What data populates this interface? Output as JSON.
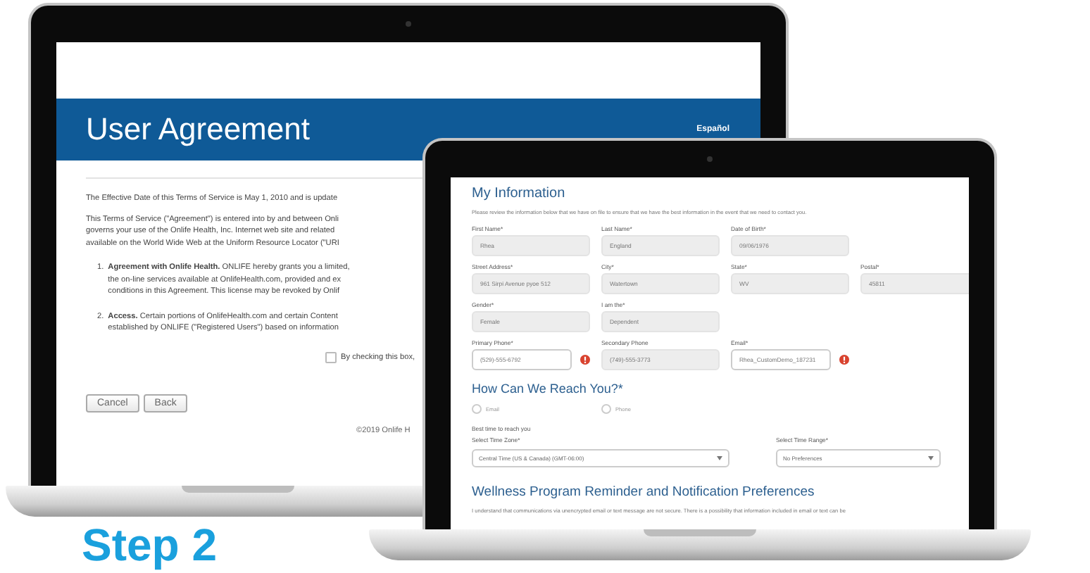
{
  "back_screen": {
    "title": "User Agreement",
    "language_link": "Español",
    "paragraphs": [
      [
        "The Effective Date of this Terms of Service is May 1, 2010 and is update"
      ],
      [
        "This Terms of Service (\"Agreement\") is entered into by and between Onli",
        "governs your use of the Onlife Health, Inc. Internet web site and related",
        "available on the World Wide Web at the Uniform Resource Locator (\"URI"
      ]
    ],
    "list": [
      {
        "number": "1.",
        "lines": [
          "**Agreement with Onlife Health.** ONLIFE hereby grants you a limited,",
          "the on-line services available at OnlifeHealth.com, provided and ex",
          "conditions in this Agreement. This license may be revoked by Onlif"
        ]
      },
      {
        "number": "2.",
        "lines": [
          "**Access.** Certain portions of OnlifeHealth.com and certain Content",
          "established by ONLIFE (\"Registered Users\") based on information"
        ]
      }
    ],
    "consent": {
      "label": "By checking this box,",
      "checked": false
    },
    "buttons": [
      "Cancel",
      "Back"
    ],
    "footer": "©2019 Onlife H"
  },
  "front_screen": {
    "title": "My Information",
    "intro": "Please review the information below that we have on file to ensure that we have the best information in the event that we need to contact you.",
    "field_rows": [
      [
        {
          "label": "First Name*",
          "value": "Rhea",
          "disabled": true,
          "error": false
        },
        {
          "label": "Last Name*",
          "value": "England",
          "disabled": true,
          "error": false
        },
        {
          "label": "Date of Birth*",
          "value": "09/06/1976",
          "disabled": true,
          "error": false
        }
      ],
      [
        {
          "label": "Street Address*",
          "value": "961 Sirpi Avenue pyoe 512",
          "disabled": true,
          "error": false
        },
        {
          "label": "City*",
          "value": "Watertown",
          "disabled": true,
          "error": false
        },
        {
          "label": "State*",
          "value": "WV",
          "disabled": true,
          "error": false
        },
        {
          "label": "Postal*",
          "value": "45811",
          "disabled": true,
          "error": false
        }
      ],
      [
        {
          "label": "Gender*",
          "value": "Female",
          "disabled": true,
          "error": false
        },
        {
          "label": "I am the*",
          "value": "Dependent",
          "disabled": true,
          "error": false
        }
      ],
      [
        {
          "label": "Primary Phone*",
          "value": "(529)-555-6792",
          "disabled": false,
          "error": true
        },
        {
          "label": "Secondary Phone",
          "value": "(749)-555-3773",
          "disabled": true,
          "error": false
        },
        {
          "label": "Email*",
          "value": "Rhea_CustomDemo_187231",
          "disabled": false,
          "error": true
        }
      ]
    ],
    "contact": {
      "heading": "How Can We Reach You?*",
      "options": [
        {
          "label": "Email",
          "selected": false
        },
        {
          "label": "Phone",
          "selected": false
        }
      ],
      "best_time": "Best time to reach you",
      "selects": [
        {
          "label": "Select Time Zone*",
          "value": "Central Time (US & Canada) (GMT-06:00)"
        },
        {
          "label": "Select Time Range*",
          "value": "No Preferences"
        }
      ]
    },
    "preferences": {
      "heading": "Wellness Program Reminder and Notification Preferences",
      "text": "I understand that communications via unencrypted email or text message are not secure. There is a possibility that information included in email or text can be"
    }
  },
  "caption": "Step 2"
}
